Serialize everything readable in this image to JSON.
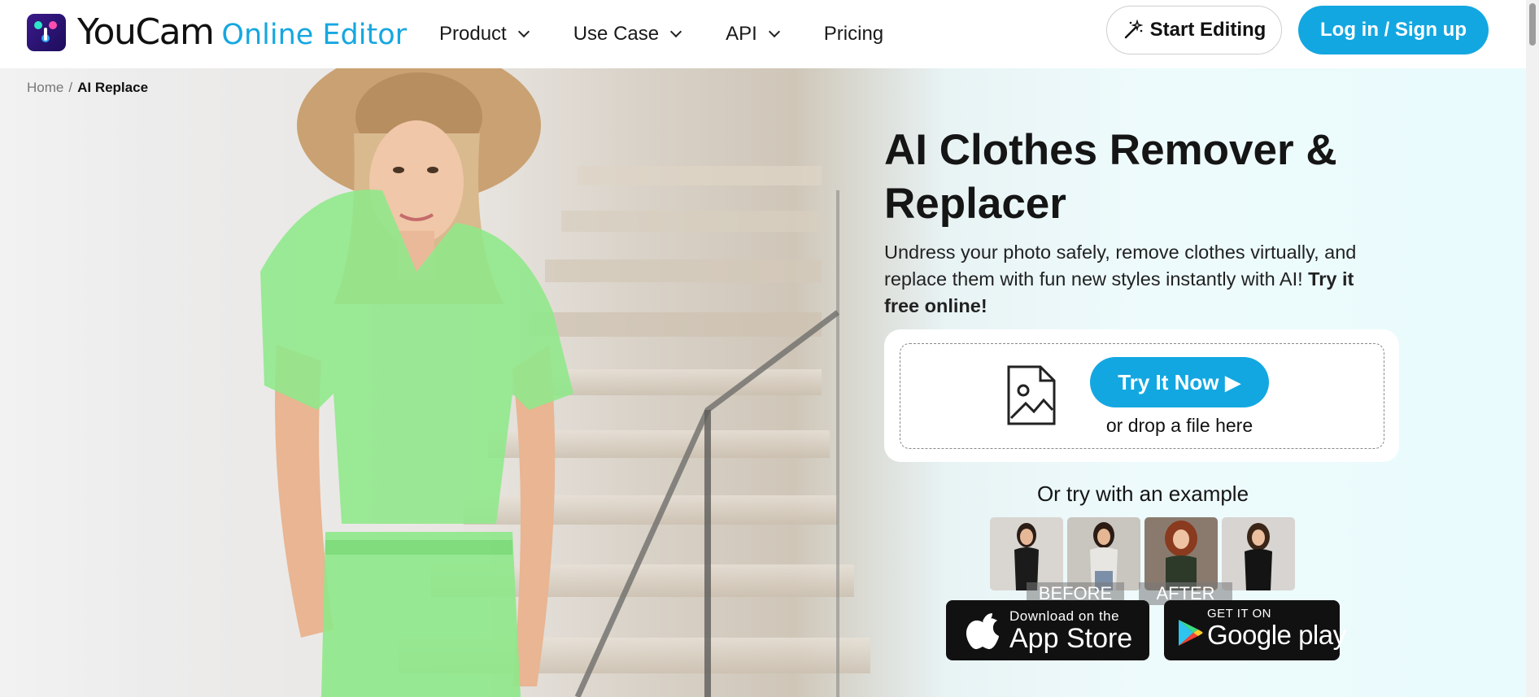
{
  "header": {
    "brand": "YouCam",
    "sub_brand": "Online Editor",
    "nav": [
      {
        "label": "Product",
        "has_dropdown": true
      },
      {
        "label": "Use Case",
        "has_dropdown": true
      },
      {
        "label": "API",
        "has_dropdown": true
      },
      {
        "label": "Pricing",
        "has_dropdown": false
      }
    ],
    "start_editing_label": "Start Editing",
    "start_editing_icon": "magic-wand-icon",
    "login_label": "Log in / Sign up"
  },
  "breadcrumb": {
    "home": "Home",
    "separator": "/",
    "current": "AI Replace"
  },
  "hero": {
    "title": "AI Clothes Remover & Replacer",
    "subtitle_plain": "Undress your photo safely, remove clothes virtually, and replace them with fun new styles instantly with AI!",
    "subtitle_bold": "Try it free online!",
    "upload": {
      "icon": "image-file-icon",
      "button_label": "Try It Now ▶",
      "drop_text": "or drop a file here"
    },
    "examples_label": "Or try with an example",
    "examples": [
      {
        "name": "example-1",
        "outfit_color": "#1b1b1b",
        "hair_color": "#2b1d16"
      },
      {
        "name": "example-2",
        "outfit_color": "#e8e6e2",
        "hair_color": "#2a1c15"
      },
      {
        "name": "example-3",
        "outfit_color": "#2d3a2a",
        "hair_color": "#8a3a1e"
      },
      {
        "name": "example-4",
        "outfit_color": "#141414",
        "hair_color": "#3a2618"
      }
    ],
    "before_label": "BEFORE",
    "after_label": "AFTER"
  },
  "stores": {
    "appstore_small": "Download on the",
    "appstore_big": "App Store",
    "googleplay_small": "GET IT ON",
    "googleplay_big": "Google play"
  },
  "colors": {
    "accent": "#13a7e1",
    "highlight_green": "#8ee88a",
    "title": "#151515"
  }
}
